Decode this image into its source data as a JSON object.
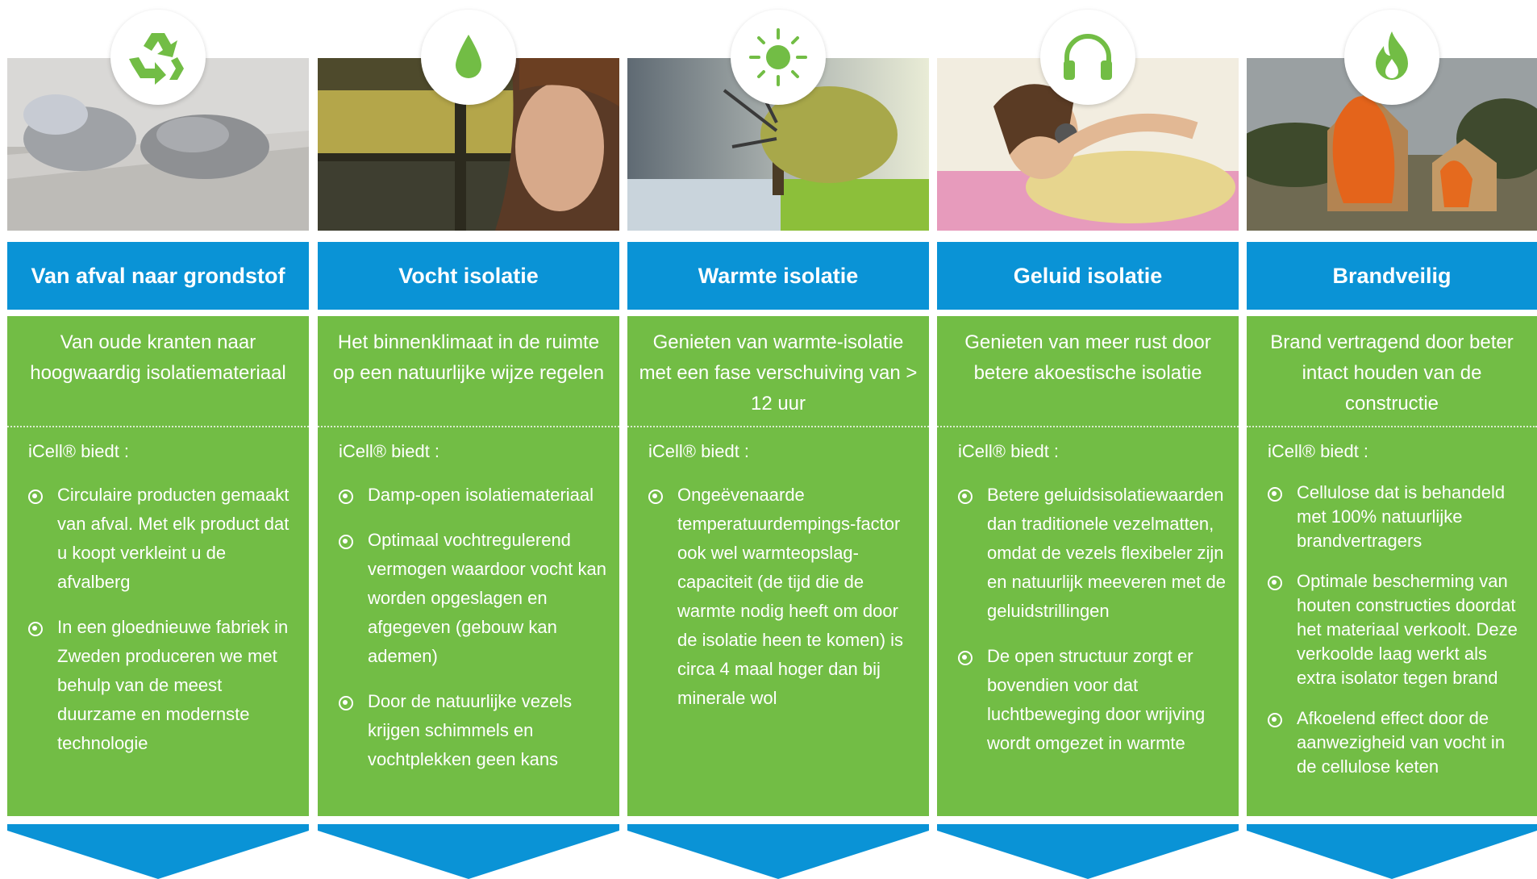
{
  "brand": {
    "blue": "#0a93d6",
    "green": "#72bd45"
  },
  "columns": [
    {
      "icon": "recycle-icon",
      "photo": "shredded paper insulation on a board",
      "title": "Van afval naar grondstof",
      "lead": "Van oude kranten naar hoogwaardig isolatiemateriaal",
      "offers_label": "iCell® biedt :",
      "bullets": [
        "Circulaire producten gemaakt van afval. Met elk product dat u koopt verkleint u de afvalberg",
        "In een gloednieuwe fabriek in Zweden produceren we met behulp van de meest duurzame en modernste technologie"
      ]
    },
    {
      "icon": "water-drop-icon",
      "photo": "girl looking through a wet window",
      "title": "Vocht isolatie",
      "lead": "Het binnenklimaat in de ruimte op een natuurlijke wijze regelen",
      "offers_label": "iCell® biedt :",
      "bullets": [
        "Damp-open isolatiemateriaal",
        "Optimaal vochtregulerend vermogen waardoor vocht kan worden opgeslagen en afgegeven (gebouw kan ademen)",
        "Door de natuurlijke vezels krijgen schimmels en vochtplekken geen kans"
      ]
    },
    {
      "icon": "sun-icon",
      "photo": "tree in winter and summer",
      "title": "Warmte isolatie",
      "lead": "Genieten van warmte-isolatie met een fase verschuiving van > 12 uur",
      "offers_label": "iCell® biedt :",
      "bullets": [
        "Ongeëvenaarde temperatuurdempings-factor ook wel warmteopslag-capaciteit (de tijd die de warmte nodig heeft om door de isolatie heen te komen) is circa 4 maal hoger dan bij minerale wol"
      ]
    },
    {
      "icon": "headphones-icon",
      "photo": "woman relaxing with headphones",
      "title": "Geluid isolatie",
      "lead": "Genieten van meer rust door betere akoestische isolatie",
      "offers_label": "iCell® biedt :",
      "bullets": [
        "Betere geluidsisolatiewaarden dan traditionele vezelmatten, omdat de vezels flexibeler zijn en natuurlijk meeveren met de geluidstrillingen",
        "De open structuur zorgt er bovendien voor dat luchtbeweging door wrijving wordt omgezet in warmte"
      ]
    },
    {
      "icon": "flame-icon",
      "photo": "burning test houses",
      "title": "Brandveilig",
      "lead": "Brand vertragend door beter intact houden van de constructie",
      "offers_label": "iCell® biedt :",
      "bullets": [
        "Cellulose dat is behandeld met 100% natuurlijke brandvertragers",
        "Optimale bescherming van houten constructies doordat het materiaal verkoolt. Deze verkoolde laag werkt als extra isolator tegen brand",
        "Afkoelend effect door de aanwezigheid van vocht in de cellulose keten"
      ]
    }
  ]
}
